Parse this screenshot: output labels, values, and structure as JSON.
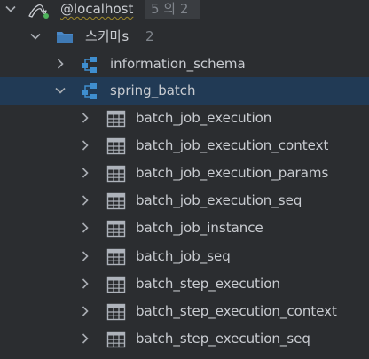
{
  "colors": {
    "background": "#2b2d30",
    "selected_row": "#213a55",
    "text": "#c9ccd1",
    "muted_text": "#7f848b",
    "schema_icon": "#3f8ecf",
    "folder_icon": "#4a88c7",
    "table_icon": "#aeb3bb"
  },
  "datasource": {
    "label": "@localhost",
    "count": "5 의 2",
    "icon": "mysql-dolphin-icon",
    "expanded": true
  },
  "schemas_folder": {
    "label": "스키마s",
    "count": "2",
    "icon": "folder-icon",
    "expanded": true
  },
  "schemas": [
    {
      "label": "information_schema",
      "icon": "schema-icon",
      "expanded": false,
      "selected": false
    },
    {
      "label": "spring_batch",
      "icon": "schema-icon",
      "expanded": true,
      "selected": true
    }
  ],
  "tables": [
    {
      "label": "batch_job_execution",
      "icon": "table-icon"
    },
    {
      "label": "batch_job_execution_context",
      "icon": "table-icon"
    },
    {
      "label": "batch_job_execution_params",
      "icon": "table-icon"
    },
    {
      "label": "batch_job_execution_seq",
      "icon": "table-icon"
    },
    {
      "label": "batch_job_instance",
      "icon": "table-icon"
    },
    {
      "label": "batch_job_seq",
      "icon": "table-icon"
    },
    {
      "label": "batch_step_execution",
      "icon": "table-icon"
    },
    {
      "label": "batch_step_execution_context",
      "icon": "table-icon"
    },
    {
      "label": "batch_step_execution_seq",
      "icon": "table-icon"
    }
  ]
}
